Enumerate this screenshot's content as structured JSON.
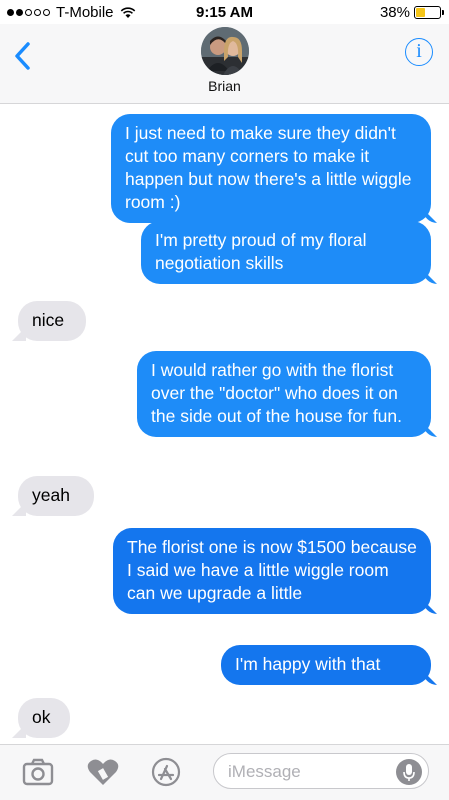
{
  "status_bar": {
    "carrier": "T-Mobile",
    "time": "9:15 AM",
    "battery_percent_label": "38%",
    "battery_level": 0.38,
    "battery_color": "#f5c518"
  },
  "header": {
    "contact_name": "Brian",
    "back_icon": "chevron-left-icon",
    "info_icon": "info-icon",
    "info_glyph": "i"
  },
  "messages": [
    {
      "from": "me",
      "text": "I just need to make sure they didn't cut too many corners to make it happen but now there's a little wiggle room :)"
    },
    {
      "from": "me",
      "text": "I'm pretty proud of my floral negotiation skills"
    },
    {
      "from": "them",
      "text": "nice"
    },
    {
      "from": "me",
      "text": "I would rather go with the florist over the \"doctor\" who does it on the side out of the house for fun."
    },
    {
      "from": "them",
      "text": "yeah"
    },
    {
      "from": "me",
      "text": "The florist one is now $1500 because I said we have a little wiggle room can we upgrade  a little"
    },
    {
      "from": "me",
      "text": "I'm happy with that"
    },
    {
      "from": "them",
      "text": "ok"
    }
  ],
  "input_bar": {
    "placeholder": "iMessage",
    "icons": [
      "camera-icon",
      "digital-touch-icon",
      "app-store-icon",
      "microphone-icon"
    ]
  },
  "colors": {
    "accent": "#1a8cff",
    "outgoing_bubble": "#1e8cf8",
    "incoming_bubble": "#e6e5ea"
  }
}
